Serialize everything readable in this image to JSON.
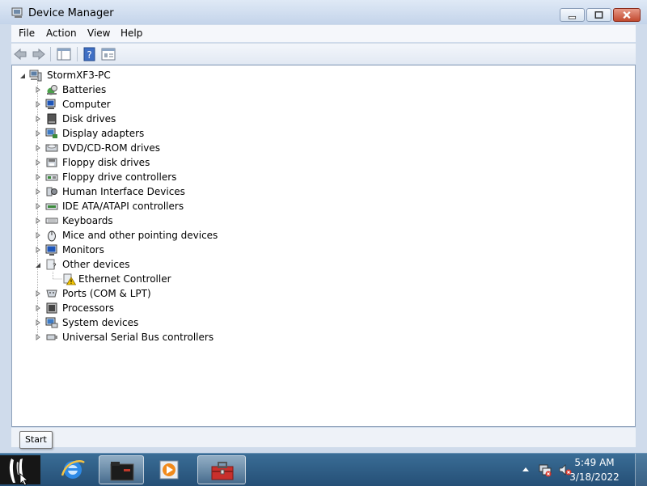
{
  "window": {
    "title": "Device Manager"
  },
  "menu": {
    "items": [
      "File",
      "Action",
      "View",
      "Help"
    ]
  },
  "tree": {
    "root": "StormXF3-PC",
    "categories": [
      "Batteries",
      "Computer",
      "Disk drives",
      "Display adapters",
      "DVD/CD-ROM drives",
      "Floppy disk drives",
      "Floppy drive controllers",
      "Human Interface Devices",
      "IDE ATA/ATAPI controllers",
      "Keyboards",
      "Mice and other pointing devices",
      "Monitors",
      "Other devices",
      "Ports (COM & LPT)",
      "Processors",
      "System devices",
      "Universal Serial Bus controllers"
    ],
    "expanded_child": "Ethernet Controller"
  },
  "tooltip": {
    "text": "Start"
  },
  "taskbar": {
    "clock_time": "5:49 AM",
    "clock_date": "3/18/2022"
  },
  "colors": {
    "title_bar": "#c4d4ea",
    "close_button": "#c24a2f",
    "taskbar": "#2b5a82",
    "warning": "#f2c400"
  },
  "icons": {
    "app": "device-manager-icon",
    "back": "back-arrow-icon",
    "forward": "forward-arrow-icon",
    "warning": "warning-icon"
  }
}
